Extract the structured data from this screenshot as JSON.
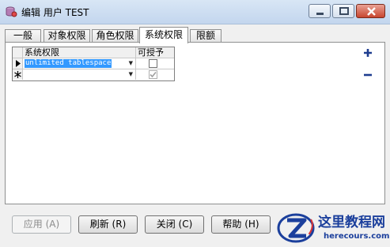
{
  "window": {
    "title": "编辑 用户 TEST",
    "controls": {
      "minimize": "minimize-icon",
      "maximize": "maximize-icon",
      "close": "close-icon"
    }
  },
  "tabs": [
    {
      "label": "一般",
      "active": false
    },
    {
      "label": "对象权限",
      "active": false
    },
    {
      "label": "角色权限",
      "active": false
    },
    {
      "label": "系统权限",
      "active": true
    },
    {
      "label": "限额",
      "active": false
    }
  ],
  "grid": {
    "columns": [
      "系统权限",
      "可授予"
    ],
    "rows": [
      {
        "marker": "current-row-arrow",
        "privilege": "unlimited tablespace",
        "grantable": false
      },
      {
        "marker": "new-row-star",
        "privilege": "",
        "grantable": true
      }
    ]
  },
  "side_actions": {
    "add": "plus-icon",
    "remove": "minus-icon"
  },
  "buttons": {
    "apply": "应用 (A)",
    "refresh": "刷新 (R)",
    "close": "关闭 (C)",
    "help": "帮助 (H)"
  },
  "watermark": {
    "name": "这里教程网",
    "url": "herecours.com"
  },
  "colors": {
    "selection": "#3399ff",
    "close_button": "#c8452f",
    "watermark": "#1b3f9c"
  }
}
